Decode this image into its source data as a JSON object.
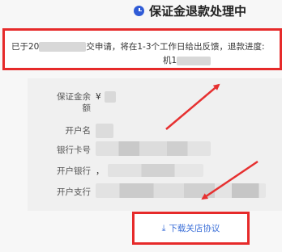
{
  "header": {
    "title": "保证金退款处理中"
  },
  "notice": {
    "text_prefix": "已于20",
    "text_middle": "交申请，将在1-3个工作日给出反馈，退款进度:",
    "line2_prefix": "机1"
  },
  "details": {
    "deposit_label_line1": "保证金余",
    "deposit_label_line2": "额",
    "deposit_value": "¥",
    "account_name_label": "开户名",
    "card_number_label": "银行卡号",
    "bank_label": "开户银行",
    "bank_value_prefix": "，",
    "branch_label": "开户支行"
  },
  "actions": {
    "download_label": "下载关店协议"
  },
  "colors": {
    "accent": "#3b6fd8",
    "highlight_border": "#e62a2a",
    "annotation_arrow": "#e63030"
  }
}
